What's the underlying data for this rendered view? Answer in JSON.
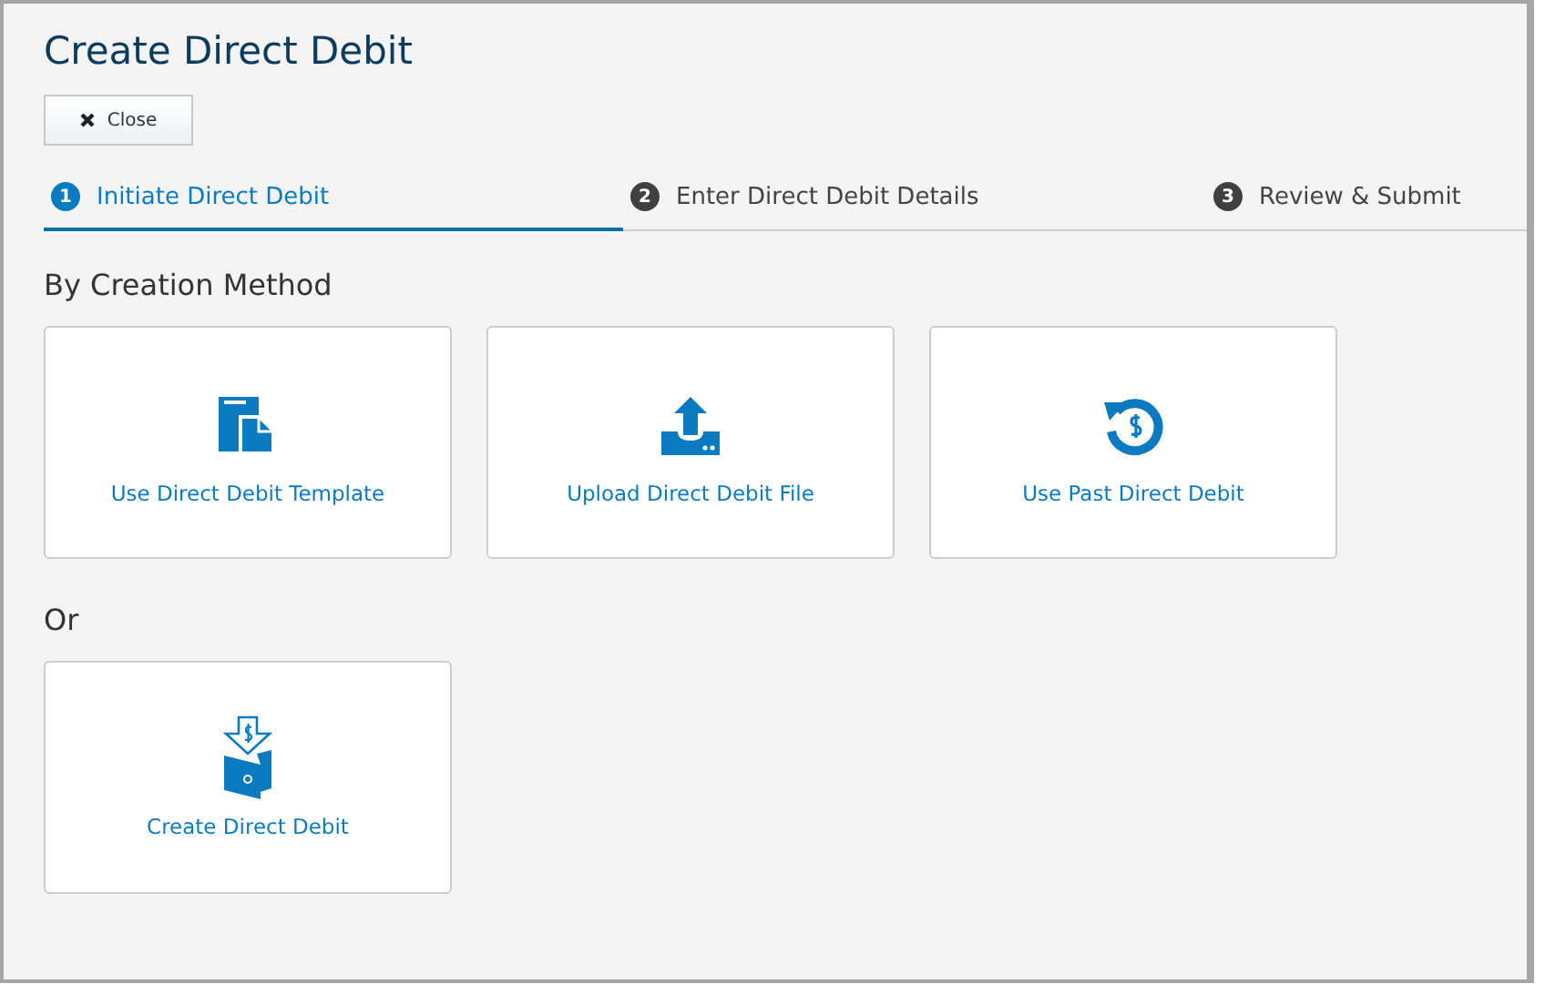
{
  "page": {
    "title": "Create Direct Debit"
  },
  "close_button": {
    "label": "Close"
  },
  "steps": [
    {
      "number": "1",
      "label": "Initiate Direct Debit",
      "selected": true
    },
    {
      "number": "2",
      "label": "Enter Direct Debit Details",
      "selected": false
    },
    {
      "number": "3",
      "label": "Review & Submit",
      "selected": false
    }
  ],
  "sections": [
    {
      "heading": "By Creation Method",
      "cards": [
        {
          "kind": "template",
          "label": "Use Direct Debit Template"
        },
        {
          "kind": "upload",
          "label": "Upload Direct Debit File"
        },
        {
          "kind": "past",
          "label": "Use Past Direct Debit"
        }
      ]
    },
    {
      "heading": "Or",
      "cards": [
        {
          "kind": "create",
          "label": "Create Direct Debit"
        }
      ]
    }
  ]
}
